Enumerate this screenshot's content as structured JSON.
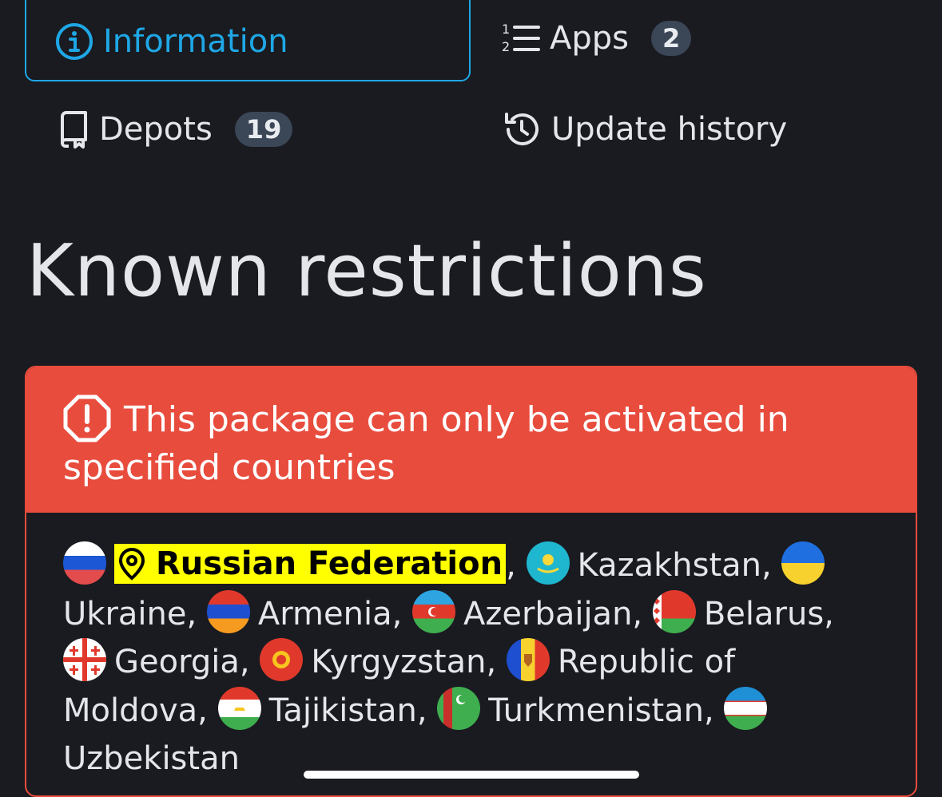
{
  "tabs": {
    "information": "Information",
    "apps": "Apps",
    "apps_count": "2",
    "depots": "Depots",
    "depots_count": "19",
    "update_history": "Update history"
  },
  "section_title": "Known restrictions",
  "alert": {
    "message": "This package can only be activated in specified countries"
  },
  "countries": [
    {
      "name": "Russian Federation",
      "highlighted": true,
      "flag": "russia-flag-icon"
    },
    {
      "name": "Kazakhstan",
      "flag": "kazakhstan-flag-icon"
    },
    {
      "name": "Ukraine",
      "flag": "ukraine-flag-icon"
    },
    {
      "name": "Armenia",
      "flag": "armenia-flag-icon"
    },
    {
      "name": "Azerbaijan",
      "flag": "azerbaijan-flag-icon"
    },
    {
      "name": "Belarus",
      "flag": "belarus-flag-icon"
    },
    {
      "name": "Georgia",
      "flag": "georgia-flag-icon"
    },
    {
      "name": "Kyrgyzstan",
      "flag": "kyrgyzstan-flag-icon"
    },
    {
      "name": "Republic of Moldova",
      "flag": "moldova-flag-icon"
    },
    {
      "name": "Tajikistan",
      "flag": "tajikistan-flag-icon"
    },
    {
      "name": "Turkmenistan",
      "flag": "turkmenistan-flag-icon"
    },
    {
      "name": "Uzbekistan",
      "flag": "uzbekistan-flag-icon"
    }
  ],
  "colors": {
    "background": "#191b20",
    "accent": "#1fa7e6",
    "alert": "#e84c3d",
    "highlight": "#ffff00",
    "badge": "#3b4656"
  }
}
